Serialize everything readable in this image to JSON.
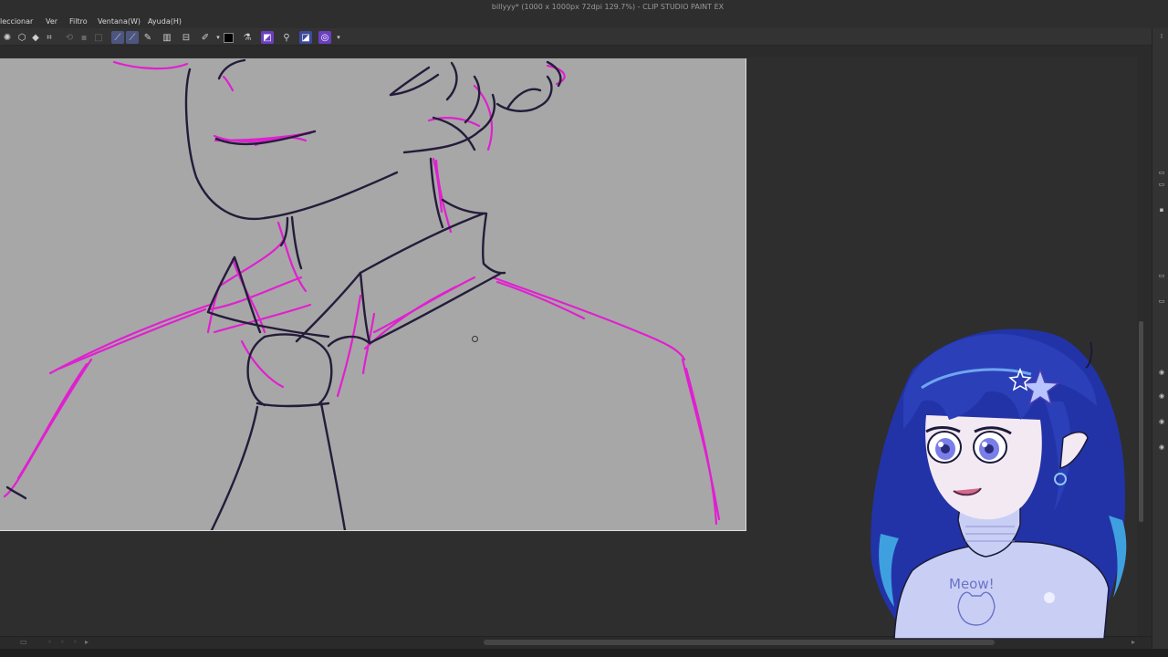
{
  "window": {
    "title": "billyyy* (1000 x 1000px 72dpi 129.7%) - CLIP STUDIO PAINT EX"
  },
  "menubar": {
    "items": [
      {
        "label": "leccionar"
      },
      {
        "label": "Ver"
      },
      {
        "label": "Filtro"
      },
      {
        "label": "Ventana(W)"
      },
      {
        "label": "Ayuda(H)"
      }
    ]
  },
  "toolbar": {
    "icons": [
      "lasso-icon",
      "fill-icon",
      "transform-icon",
      "undo-icon",
      "redo-icon",
      "pen-active-icon",
      "pen-active-icon-2",
      "pencil-icon",
      "eraser-icon",
      "ruler-icon",
      "brush-icon",
      "color-black-icon",
      "dropper-icon",
      "mask-icon",
      "fill-bucket-icon",
      "vector-icon",
      "selection-purple-icon",
      "chevron-down-icon"
    ]
  },
  "colors": {
    "canvas_bg": "#a7a7a7",
    "line_dark": "#241c3a",
    "line_magenta": "#e020d0",
    "workspace": "#2e2e2e",
    "hair": "#2a3fb8",
    "sweater": "#c9cff4"
  },
  "avatar": {
    "sweater_text": "Meow!"
  }
}
